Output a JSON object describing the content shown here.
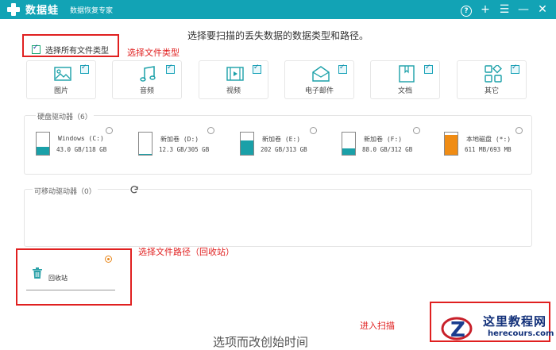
{
  "app": {
    "name": "数据蛙",
    "tagline": "数据恢复专家"
  },
  "titlebar_icons": [
    "help-icon",
    "plus-icon",
    "menu-icon",
    "minimize-icon",
    "close-icon"
  ],
  "instruction": "选择要扫描的丢失数据的数据类型和路径。",
  "select_all": {
    "label": "选择所有文件类型",
    "checked": true
  },
  "annotations": {
    "file_type": "选择文件类型",
    "file_path": "选择文件路径（回收站）",
    "enter_scan": "进入扫描"
  },
  "file_types": [
    {
      "label": "图片",
      "icon": "image-icon",
      "checked": true
    },
    {
      "label": "音频",
      "icon": "music-icon",
      "checked": true
    },
    {
      "label": "视频",
      "icon": "video-icon",
      "checked": true
    },
    {
      "label": "电子邮件",
      "icon": "email-icon",
      "checked": true
    },
    {
      "label": "文档",
      "icon": "document-icon",
      "checked": true
    },
    {
      "label": "其它",
      "icon": "other-icon",
      "checked": true
    }
  ],
  "hard_drives": {
    "title": "硬盘驱动器（6）",
    "items": [
      {
        "name": "Windows (C:)",
        "size": "43.0 GB/118 GB",
        "fill_fraction": 0.36,
        "fill_color": "#1aa0a8",
        "selected": false
      },
      {
        "name": "新加卷 (D:)",
        "size": "12.3 GB/305 GB",
        "fill_fraction": 0.04,
        "fill_color": "#1aa0a8",
        "selected": false
      },
      {
        "name": "新加卷 (E:)",
        "size": "202 GB/313 GB",
        "fill_fraction": 0.65,
        "fill_color": "#1aa0a8",
        "selected": false
      },
      {
        "name": "新加卷 (F:)",
        "size": "88.0 GB/312 GB",
        "fill_fraction": 0.28,
        "fill_color": "#1aa0a8",
        "selected": false
      },
      {
        "name": "本地磁盘 (*:)",
        "size": "611 MB/693 MB",
        "fill_fraction": 0.88,
        "fill_color": "#f08c14",
        "selected": false
      }
    ]
  },
  "removable_drives": {
    "title": "可移动驱动器（0）"
  },
  "recycle_bin": {
    "label": "回收站",
    "selected": true
  },
  "watermark": {
    "title": "这里教程网",
    "url": "herecours.com"
  },
  "bottom_text": "选项而改创始时间",
  "accent_color": "#12a3b5"
}
